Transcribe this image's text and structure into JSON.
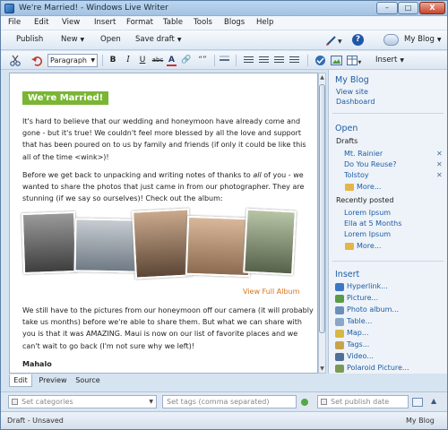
{
  "window": {
    "title": "We're Married! - Windows Live Writer",
    "min": "–",
    "max": "□",
    "close": "X"
  },
  "menu": [
    "File",
    "Edit",
    "View",
    "Insert",
    "Format",
    "Table",
    "Tools",
    "Blogs",
    "Help"
  ],
  "command_bar": {
    "publish": "Publish",
    "new": "New",
    "open": "Open",
    "save_draft": "Save draft",
    "help": "?",
    "blog": "My Blog"
  },
  "format_bar": {
    "paragraph": "Paragraph",
    "bold": "B",
    "italic": "I",
    "underline": "U",
    "strike": "abc",
    "font_color": "A",
    "link": "🔗",
    "quote": "“”",
    "insert": "Insert"
  },
  "post": {
    "title": "We're Married!",
    "p1": "It's hard to believe that our wedding and honeymoon have already come and gone - but it's true!  We couldn't feel more blessed by all the love and support that has been poured on to us by family and friends (if only it could be like this all of the time <wink>)!",
    "p2": "Before we get back to unpacking and writing notes of thanks to all of you - we wanted to share the photos that just came in from our photographer.  They are stunning (if we say so ourselves)!  Check out the album:",
    "view_album": "View Full Album",
    "p3": "We still have to the pictures from our honeymoon off our camera (it will probably take us months) before we're able to share them.  But what we can share with you is that it was AMAZING.  Maui is now on our list of favorite places and we can't wait to go back (I'm not sure why we left)!",
    "p4": "Mahalo"
  },
  "sidebar": {
    "heading": "My Blog",
    "view_site": "View site",
    "dashboard": "Dashboard",
    "open_heading": "Open",
    "drafts_label": "Drafts",
    "drafts": [
      "Mt. Rainier",
      "Do You Reuse?",
      "Tolstoy"
    ],
    "remove_glyph": "✕",
    "more": "More...",
    "recent_label": "Recently posted",
    "recent": [
      "Lorem Ipsum",
      "Ella at 5 Months",
      "Lorem Ipsum"
    ],
    "insert_heading": "Insert",
    "insert_items": [
      "Hyperlink...",
      "Picture...",
      "Photo album...",
      "Table...",
      "Map...",
      "Tags...",
      "Video...",
      "Polaroid Picture..."
    ]
  },
  "tabs": [
    "Edit",
    "Preview",
    "Source"
  ],
  "properties": {
    "categories": "Set categories",
    "tags": "Set tags (comma separated)",
    "publish_date": "Set publish date"
  },
  "status": {
    "left": "Draft - Unsaved",
    "right": "My Blog"
  },
  "colors": {
    "title_bg": "#7ab534",
    "link": "#1d5ca5",
    "album_link": "#d9751c"
  }
}
